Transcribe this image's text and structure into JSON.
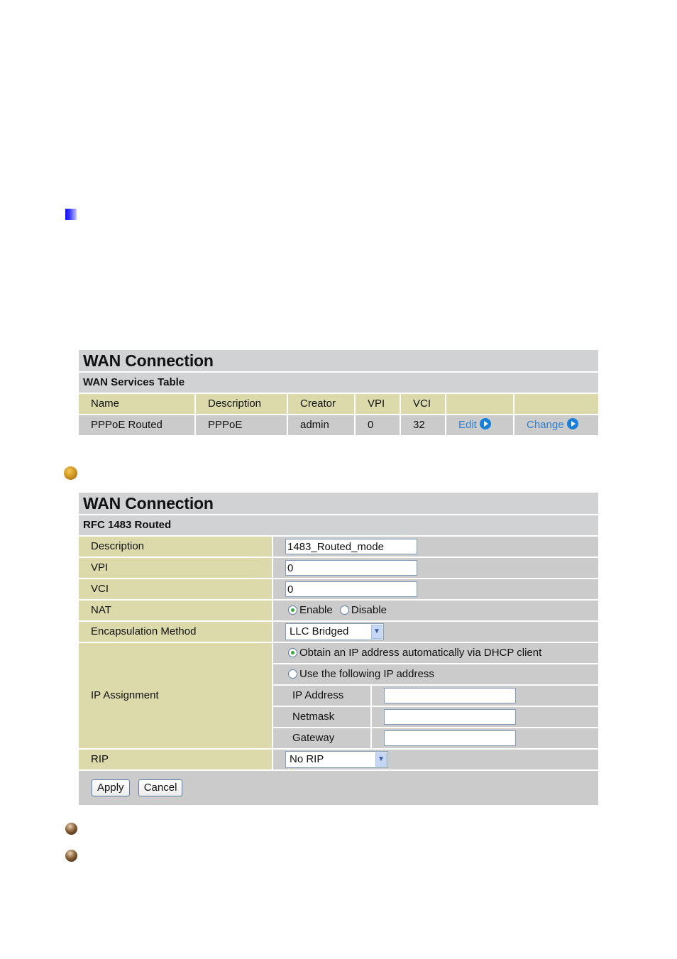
{
  "services_panel": {
    "title": "WAN Connection",
    "subtitle": "WAN Services Table",
    "columns": [
      "Name",
      "Description",
      "Creator",
      "VPI",
      "VCI",
      "",
      ""
    ],
    "rows": [
      {
        "name": "PPPoE Routed",
        "description": "PPPoE",
        "creator": "admin",
        "vpi": "0",
        "vci": "32",
        "edit_label": "Edit",
        "change_label": "Change"
      }
    ]
  },
  "config_panel": {
    "title": "WAN Connection",
    "subtitle": "RFC 1483 Routed",
    "description": {
      "label": "Description",
      "value": "1483_Routed_mode"
    },
    "vpi": {
      "label": "VPI",
      "value": "0"
    },
    "vci": {
      "label": "VCI",
      "value": "0"
    },
    "nat": {
      "label": "NAT",
      "options": [
        "Enable",
        "Disable"
      ],
      "selected": "Enable"
    },
    "encapsulation": {
      "label": "Encapsulation Method",
      "value": "LLC Bridged"
    },
    "ip_assignment": {
      "label": "IP Assignment",
      "option_dhcp": "Obtain an IP address automatically via DHCP client",
      "option_static": "Use the following IP address",
      "selected": "dhcp",
      "ip_address": {
        "label": "IP Address",
        "value": ""
      },
      "netmask": {
        "label": "Netmask",
        "value": ""
      },
      "gateway": {
        "label": "Gateway",
        "value": ""
      }
    },
    "rip": {
      "label": "RIP",
      "value": "No RIP"
    },
    "apply_label": "Apply",
    "cancel_label": "Cancel"
  },
  "icons": {
    "section_marker": "blue-gradient-square",
    "bullet_1": "gold-ball-bullet",
    "bullet_2": "bronze-ball-bullet",
    "bullet_3": "bronze-ball-bullet"
  },
  "colors": {
    "header_gray": "#d1d2d4",
    "label_tan": "#dcdaab",
    "cell_gray": "#cbcbcb",
    "link_blue": "#2f7fd0"
  }
}
